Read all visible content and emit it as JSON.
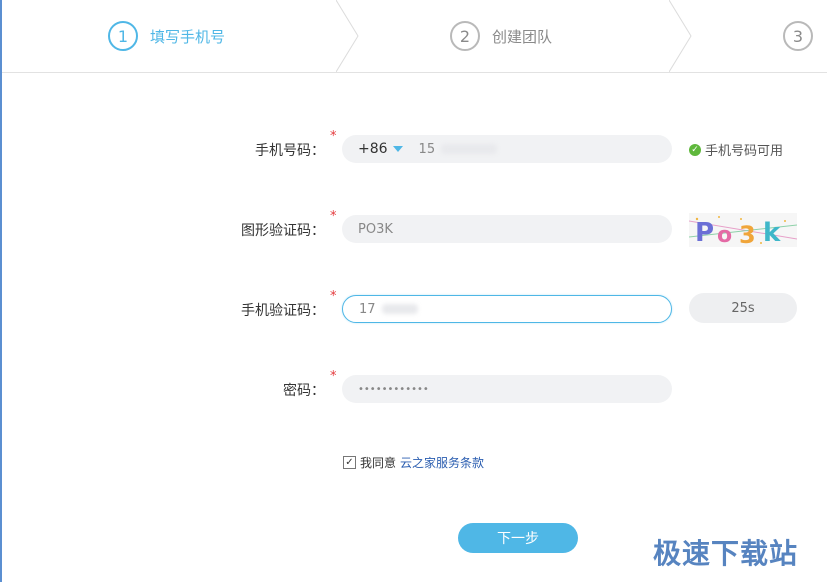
{
  "steps": [
    {
      "num": "1",
      "label": "填写手机号",
      "active": true
    },
    {
      "num": "2",
      "label": "创建团队",
      "active": false
    },
    {
      "num": "3",
      "label": "",
      "active": false
    }
  ],
  "form": {
    "phone": {
      "label": "手机号码：",
      "country_code": "+86",
      "value": "15",
      "status": "手机号码可用"
    },
    "captcha": {
      "label": "图形验证码：",
      "value": "PO3K",
      "image_text": "Po3k"
    },
    "sms": {
      "label": "手机验证码：",
      "value": "17",
      "countdown": "25s"
    },
    "password": {
      "label": "密码：",
      "value": "••••••••••••"
    }
  },
  "agreement": {
    "prefix": "我同意",
    "link": "云之家服务条款",
    "checked": true
  },
  "next_button": "下一步",
  "watermark": "极速下载站",
  "colors": {
    "accent": "#4fb7e6",
    "required": "#e4393c",
    "ok": "#5fb83c"
  }
}
